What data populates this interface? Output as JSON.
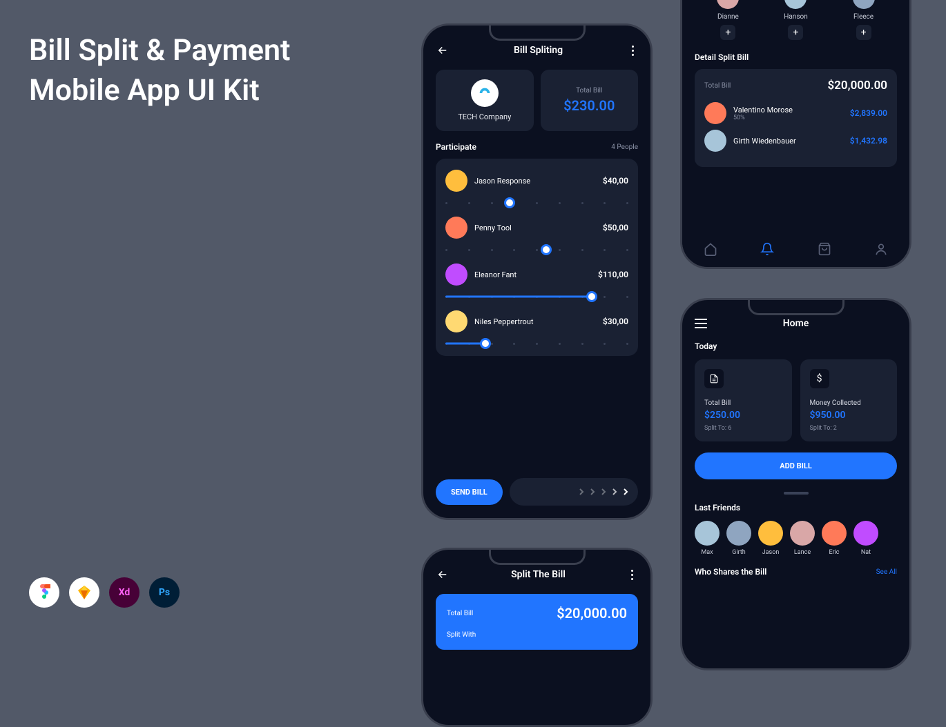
{
  "hero": {
    "line1": "Bill Split & Payment",
    "line2": "Mobile App UI Kit"
  },
  "tools": {
    "figma": "F",
    "sketch": "◆",
    "xd": "Xd",
    "ps": "Ps"
  },
  "screen1": {
    "title": "Bill Spliting",
    "company": "TECH Company",
    "totalLabel": "Total Bill",
    "totalAmount": "$230.00",
    "participateLabel": "Participate",
    "peopleCount": "4 People",
    "participants": [
      {
        "name": "Jason Response",
        "amount": "$40,00",
        "pct": 35
      },
      {
        "name": "Penny Tool",
        "amount": "$50,00",
        "pct": 55
      },
      {
        "name": "Eleanor Fant",
        "amount": "$110,00",
        "pct": 80
      },
      {
        "name": "Niles Peppertrout",
        "amount": "$30,00",
        "pct": 22
      }
    ],
    "sendBill": "SEND BILL"
  },
  "screen2": {
    "friends": [
      {
        "name": "Dianne"
      },
      {
        "name": "Hanson"
      },
      {
        "name": "Fleece"
      }
    ],
    "detailTitle": "Detail Split Bill",
    "totalLabel": "Total Bill",
    "totalAmount": "$20,000.00",
    "splits": [
      {
        "name": "Valentino Morose",
        "pct": "50%",
        "amount": "$2,839.00"
      },
      {
        "name": "Girth Wiedenbauer",
        "pct": "",
        "amount": "$1,432.98"
      }
    ]
  },
  "screen3": {
    "title": "Home",
    "todayLabel": "Today",
    "stats": [
      {
        "label": "Total Bill",
        "value": "$250.00",
        "meta": "Split To: 6",
        "icon": "file"
      },
      {
        "label": "Money Collected",
        "value": "$950.00",
        "meta": "Split To: 2",
        "icon": "dollar"
      }
    ],
    "addBill": "ADD BILL",
    "lastFriendsTitle": "Last Friends",
    "lastFriends": [
      {
        "name": "Max"
      },
      {
        "name": "Girth"
      },
      {
        "name": "Jason"
      },
      {
        "name": "Lance"
      },
      {
        "name": "Eric"
      },
      {
        "name": "Nat"
      }
    ],
    "whoTitle": "Who Shares the Bill",
    "seeAll": "See All"
  },
  "screen4": {
    "title": "Split The Bill",
    "totalLabel": "Total Bill",
    "totalAmount": "$20,000.00",
    "splitWith": "Split With"
  }
}
